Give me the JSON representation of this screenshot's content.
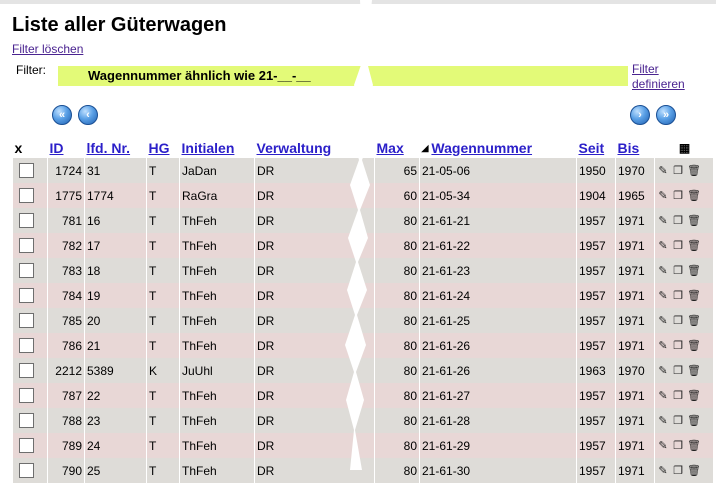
{
  "page": {
    "title": "Liste aller Güterwagen",
    "filter_clear": "Filter löschen",
    "filter_label": "Filter:",
    "filter_value": "Wagennummer ähnlich wie 21-__-__",
    "filter_define_line1": "Filter",
    "filter_define_line2": "definieren"
  },
  "icons": {
    "first": "double-left-arrow-icon",
    "prev": "left-arrow-icon",
    "next": "right-arrow-icon",
    "last": "double-right-arrow-icon",
    "table": "table-icon",
    "edit": "edit-icon",
    "copy": "copy-icon",
    "delete": "trash-icon",
    "sort": "sort-desc-icon"
  },
  "columns": {
    "select": "x",
    "id": "ID",
    "lfd": "lfd. Nr.",
    "hg": "HG",
    "initialen": "Initialen",
    "verwaltung": "Verwaltung",
    "max": "Max",
    "wagennummer": "Wagennummer",
    "seit": "Seit",
    "bis": "Bis"
  },
  "rows": [
    {
      "id": "1724",
      "lfd": "31",
      "hg": "T",
      "initialen": "JaDan",
      "verwaltung": "DR",
      "max": "65",
      "wagennummer": "21-05-06",
      "seit": "1950",
      "bis": "1970"
    },
    {
      "id": "1775",
      "lfd": "1774",
      "hg": "T",
      "initialen": "RaGra",
      "verwaltung": "DR",
      "max": "60",
      "wagennummer": "21-05-34",
      "seit": "1904",
      "bis": "1965"
    },
    {
      "id": "781",
      "lfd": "16",
      "hg": "T",
      "initialen": "ThFeh",
      "verwaltung": "DR",
      "max": "80",
      "wagennummer": "21-61-21",
      "seit": "1957",
      "bis": "1971"
    },
    {
      "id": "782",
      "lfd": "17",
      "hg": "T",
      "initialen": "ThFeh",
      "verwaltung": "DR",
      "max": "80",
      "wagennummer": "21-61-22",
      "seit": "1957",
      "bis": "1971"
    },
    {
      "id": "783",
      "lfd": "18",
      "hg": "T",
      "initialen": "ThFeh",
      "verwaltung": "DR",
      "max": "80",
      "wagennummer": "21-61-23",
      "seit": "1957",
      "bis": "1971"
    },
    {
      "id": "784",
      "lfd": "19",
      "hg": "T",
      "initialen": "ThFeh",
      "verwaltung": "DR",
      "max": "80",
      "wagennummer": "21-61-24",
      "seit": "1957",
      "bis": "1971"
    },
    {
      "id": "785",
      "lfd": "20",
      "hg": "T",
      "initialen": "ThFeh",
      "verwaltung": "DR",
      "max": "80",
      "wagennummer": "21-61-25",
      "seit": "1957",
      "bis": "1971"
    },
    {
      "id": "786",
      "lfd": "21",
      "hg": "T",
      "initialen": "ThFeh",
      "verwaltung": "DR",
      "max": "80",
      "wagennummer": "21-61-26",
      "seit": "1957",
      "bis": "1971"
    },
    {
      "id": "2212",
      "lfd": "5389",
      "hg": "K",
      "initialen": "JuUhl",
      "verwaltung": "DR",
      "max": "80",
      "wagennummer": "21-61-26",
      "seit": "1963",
      "bis": "1970"
    },
    {
      "id": "787",
      "lfd": "22",
      "hg": "T",
      "initialen": "ThFeh",
      "verwaltung": "DR",
      "max": "80",
      "wagennummer": "21-61-27",
      "seit": "1957",
      "bis": "1971"
    },
    {
      "id": "788",
      "lfd": "23",
      "hg": "T",
      "initialen": "ThFeh",
      "verwaltung": "DR",
      "max": "80",
      "wagennummer": "21-61-28",
      "seit": "1957",
      "bis": "1971"
    },
    {
      "id": "789",
      "lfd": "24",
      "hg": "T",
      "initialen": "ThFeh",
      "verwaltung": "DR",
      "max": "80",
      "wagennummer": "21-61-29",
      "seit": "1957",
      "bis": "1971"
    },
    {
      "id": "790",
      "lfd": "25",
      "hg": "T",
      "initialen": "ThFeh",
      "verwaltung": "DR",
      "max": "80",
      "wagennummer": "21-61-30",
      "seit": "1957",
      "bis": "1971"
    }
  ]
}
